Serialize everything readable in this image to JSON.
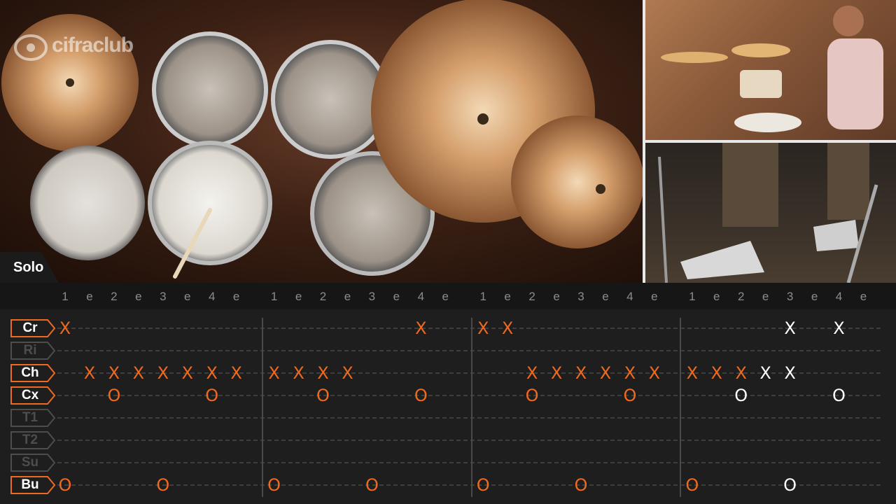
{
  "video": {
    "logo_text": "cifraclub",
    "section_label": "Solo"
  },
  "count_labels": [
    "1",
    "e",
    "2",
    "e",
    "3",
    "e",
    "4",
    "e",
    "1",
    "e",
    "2",
    "e",
    "3",
    "e",
    "4",
    "e",
    "1",
    "e",
    "2",
    "e",
    "3",
    "e",
    "4",
    "e",
    "1",
    "e",
    "2",
    "e",
    "3",
    "e",
    "4",
    "e"
  ],
  "drums": [
    {
      "label": "Cr",
      "active": true
    },
    {
      "label": "Ri",
      "active": false
    },
    {
      "label": "Ch",
      "active": true
    },
    {
      "label": "Cx",
      "active": true
    },
    {
      "label": "T1",
      "active": false
    },
    {
      "label": "T2",
      "active": false
    },
    {
      "label": "Su",
      "active": false
    },
    {
      "label": "Bu",
      "active": true
    }
  ],
  "colors": {
    "accent": "#ef6a21",
    "played": "#ffffff",
    "inactive": "#4d4d4d"
  },
  "notes": [
    {
      "row": 0,
      "step": 0,
      "symbol": "X",
      "state": "accent"
    },
    {
      "row": 0,
      "step": 14,
      "symbol": "X",
      "state": "accent"
    },
    {
      "row": 0,
      "step": 16,
      "symbol": "X",
      "state": "accent"
    },
    {
      "row": 0,
      "step": 17,
      "symbol": "X",
      "state": "accent"
    },
    {
      "row": 0,
      "step": 28,
      "symbol": "X",
      "state": "played"
    },
    {
      "row": 0,
      "step": 30,
      "symbol": "X",
      "state": "played"
    },
    {
      "row": 2,
      "step": 1,
      "symbol": "X",
      "state": "accent"
    },
    {
      "row": 2,
      "step": 2,
      "symbol": "X",
      "state": "accent"
    },
    {
      "row": 2,
      "step": 3,
      "symbol": "X",
      "state": "accent"
    },
    {
      "row": 2,
      "step": 4,
      "symbol": "X",
      "state": "accent"
    },
    {
      "row": 2,
      "step": 5,
      "symbol": "X",
      "state": "accent"
    },
    {
      "row": 2,
      "step": 6,
      "symbol": "X",
      "state": "accent"
    },
    {
      "row": 2,
      "step": 7,
      "symbol": "X",
      "state": "accent"
    },
    {
      "row": 2,
      "step": 8,
      "symbol": "X",
      "state": "accent"
    },
    {
      "row": 2,
      "step": 9,
      "symbol": "X",
      "state": "accent"
    },
    {
      "row": 2,
      "step": 10,
      "symbol": "X",
      "state": "accent"
    },
    {
      "row": 2,
      "step": 11,
      "symbol": "X",
      "state": "accent"
    },
    {
      "row": 2,
      "step": 18,
      "symbol": "X",
      "state": "accent"
    },
    {
      "row": 2,
      "step": 19,
      "symbol": "X",
      "state": "accent"
    },
    {
      "row": 2,
      "step": 20,
      "symbol": "X",
      "state": "accent"
    },
    {
      "row": 2,
      "step": 21,
      "symbol": "X",
      "state": "accent"
    },
    {
      "row": 2,
      "step": 22,
      "symbol": "X",
      "state": "accent"
    },
    {
      "row": 2,
      "step": 23,
      "symbol": "X",
      "state": "accent"
    },
    {
      "row": 2,
      "step": 24,
      "symbol": "X",
      "state": "accent"
    },
    {
      "row": 2,
      "step": 25,
      "symbol": "X",
      "state": "accent"
    },
    {
      "row": 2,
      "step": 26,
      "symbol": "X",
      "state": "accent"
    },
    {
      "row": 2,
      "step": 27,
      "symbol": "X",
      "state": "played"
    },
    {
      "row": 2,
      "step": 28,
      "symbol": "X",
      "state": "played"
    },
    {
      "row": 3,
      "step": 2,
      "symbol": "O",
      "state": "accent"
    },
    {
      "row": 3,
      "step": 6,
      "symbol": "O",
      "state": "accent"
    },
    {
      "row": 3,
      "step": 10,
      "symbol": "O",
      "state": "accent"
    },
    {
      "row": 3,
      "step": 14,
      "symbol": "O",
      "state": "accent"
    },
    {
      "row": 3,
      "step": 18,
      "symbol": "O",
      "state": "accent"
    },
    {
      "row": 3,
      "step": 22,
      "symbol": "O",
      "state": "accent"
    },
    {
      "row": 3,
      "step": 26,
      "symbol": "O",
      "state": "played"
    },
    {
      "row": 3,
      "step": 30,
      "symbol": "O",
      "state": "played"
    },
    {
      "row": 7,
      "step": 0,
      "symbol": "O",
      "state": "accent"
    },
    {
      "row": 7,
      "step": 4,
      "symbol": "O",
      "state": "accent"
    },
    {
      "row": 7,
      "step": 8,
      "symbol": "O",
      "state": "accent"
    },
    {
      "row": 7,
      "step": 12,
      "symbol": "O",
      "state": "accent"
    },
    {
      "row": 7,
      "step": 16,
      "symbol": "O",
      "state": "accent"
    },
    {
      "row": 7,
      "step": 20,
      "symbol": "O",
      "state": "accent"
    },
    {
      "row": 7,
      "step": 24,
      "symbol": "O",
      "state": "accent"
    },
    {
      "row": 7,
      "step": 28,
      "symbol": "O",
      "state": "played"
    }
  ]
}
